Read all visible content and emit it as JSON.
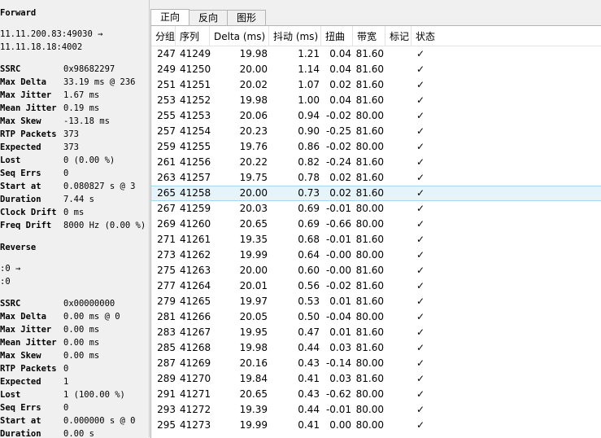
{
  "left": {
    "forward": {
      "title": "Forward",
      "addr1": "11.11.200.83:49030 →",
      "addr2": "11.11.18.18:4002",
      "stats": [
        {
          "k": "SSRC",
          "v": "0x98682297"
        },
        {
          "k": "Max Delta",
          "v": "33.19 ms @ 236"
        },
        {
          "k": "Max Jitter",
          "v": "1.67 ms"
        },
        {
          "k": "Mean Jitter",
          "v": "0.19 ms"
        },
        {
          "k": "Max Skew",
          "v": "-13.18 ms"
        },
        {
          "k": "RTP Packets",
          "v": "373"
        },
        {
          "k": "Expected",
          "v": "373"
        },
        {
          "k": "Lost",
          "v": "0 (0.00 %)"
        },
        {
          "k": "Seq Errs",
          "v": "0"
        },
        {
          "k": "Start at",
          "v": "0.080827 s @ 3"
        },
        {
          "k": "Duration",
          "v": "7.44 s"
        },
        {
          "k": "Clock Drift",
          "v": "0 ms"
        },
        {
          "k": "Freq Drift",
          "v": "8000 Hz (0.00 %)"
        }
      ]
    },
    "reverse": {
      "title": "Reverse",
      "addr1": ":0 →",
      "addr2": ":0",
      "stats": [
        {
          "k": "SSRC",
          "v": "0x00000000"
        },
        {
          "k": "Max Delta",
          "v": "0.00 ms @ 0"
        },
        {
          "k": "Max Jitter",
          "v": "0.00 ms"
        },
        {
          "k": "Mean Jitter",
          "v": "0.00 ms"
        },
        {
          "k": "Max Skew",
          "v": "0.00 ms"
        },
        {
          "k": "RTP Packets",
          "v": "0"
        },
        {
          "k": "Expected",
          "v": "1"
        },
        {
          "k": "Lost",
          "v": "1 (100.00 %)"
        },
        {
          "k": "Seq Errs",
          "v": "0"
        },
        {
          "k": "Start at",
          "v": "0.000000 s @ 0"
        },
        {
          "k": "Duration",
          "v": "0.00 s"
        }
      ]
    }
  },
  "tabs": [
    "正向",
    "反向",
    "图形"
  ],
  "active_tab": 0,
  "columns": [
    "分组",
    "序列",
    "Delta (ms)",
    "抖动 (ms)",
    "扭曲",
    "带宽",
    "标记",
    "状态"
  ],
  "selected_row": 9,
  "rows": [
    {
      "pkt": "247",
      "seq": "41249",
      "delta": "19.98",
      "jitter": "1.21",
      "skew": "0.04",
      "bw": "81.60",
      "mark": "",
      "status": "✓"
    },
    {
      "pkt": "249",
      "seq": "41250",
      "delta": "20.00",
      "jitter": "1.14",
      "skew": "0.04",
      "bw": "81.60",
      "mark": "",
      "status": "✓"
    },
    {
      "pkt": "251",
      "seq": "41251",
      "delta": "20.02",
      "jitter": "1.07",
      "skew": "0.02",
      "bw": "81.60",
      "mark": "",
      "status": "✓"
    },
    {
      "pkt": "253",
      "seq": "41252",
      "delta": "19.98",
      "jitter": "1.00",
      "skew": "0.04",
      "bw": "81.60",
      "mark": "",
      "status": "✓"
    },
    {
      "pkt": "255",
      "seq": "41253",
      "delta": "20.06",
      "jitter": "0.94",
      "skew": "-0.02",
      "bw": "80.00",
      "mark": "",
      "status": "✓"
    },
    {
      "pkt": "257",
      "seq": "41254",
      "delta": "20.23",
      "jitter": "0.90",
      "skew": "-0.25",
      "bw": "81.60",
      "mark": "",
      "status": "✓"
    },
    {
      "pkt": "259",
      "seq": "41255",
      "delta": "19.76",
      "jitter": "0.86",
      "skew": "-0.02",
      "bw": "80.00",
      "mark": "",
      "status": "✓"
    },
    {
      "pkt": "261",
      "seq": "41256",
      "delta": "20.22",
      "jitter": "0.82",
      "skew": "-0.24",
      "bw": "81.60",
      "mark": "",
      "status": "✓"
    },
    {
      "pkt": "263",
      "seq": "41257",
      "delta": "19.75",
      "jitter": "0.78",
      "skew": "0.02",
      "bw": "81.60",
      "mark": "",
      "status": "✓"
    },
    {
      "pkt": "265",
      "seq": "41258",
      "delta": "20.00",
      "jitter": "0.73",
      "skew": "0.02",
      "bw": "81.60",
      "mark": "",
      "status": "✓"
    },
    {
      "pkt": "267",
      "seq": "41259",
      "delta": "20.03",
      "jitter": "0.69",
      "skew": "-0.01",
      "bw": "80.00",
      "mark": "",
      "status": "✓"
    },
    {
      "pkt": "269",
      "seq": "41260",
      "delta": "20.65",
      "jitter": "0.69",
      "skew": "-0.66",
      "bw": "80.00",
      "mark": "",
      "status": "✓"
    },
    {
      "pkt": "271",
      "seq": "41261",
      "delta": "19.35",
      "jitter": "0.68",
      "skew": "-0.01",
      "bw": "81.60",
      "mark": "",
      "status": "✓"
    },
    {
      "pkt": "273",
      "seq": "41262",
      "delta": "19.99",
      "jitter": "0.64",
      "skew": "-0.00",
      "bw": "80.00",
      "mark": "",
      "status": "✓"
    },
    {
      "pkt": "275",
      "seq": "41263",
      "delta": "20.00",
      "jitter": "0.60",
      "skew": "-0.00",
      "bw": "81.60",
      "mark": "",
      "status": "✓"
    },
    {
      "pkt": "277",
      "seq": "41264",
      "delta": "20.01",
      "jitter": "0.56",
      "skew": "-0.02",
      "bw": "81.60",
      "mark": "",
      "status": "✓"
    },
    {
      "pkt": "279",
      "seq": "41265",
      "delta": "19.97",
      "jitter": "0.53",
      "skew": "0.01",
      "bw": "81.60",
      "mark": "",
      "status": "✓"
    },
    {
      "pkt": "281",
      "seq": "41266",
      "delta": "20.05",
      "jitter": "0.50",
      "skew": "-0.04",
      "bw": "80.00",
      "mark": "",
      "status": "✓"
    },
    {
      "pkt": "283",
      "seq": "41267",
      "delta": "19.95",
      "jitter": "0.47",
      "skew": "0.01",
      "bw": "81.60",
      "mark": "",
      "status": "✓"
    },
    {
      "pkt": "285",
      "seq": "41268",
      "delta": "19.98",
      "jitter": "0.44",
      "skew": "0.03",
      "bw": "81.60",
      "mark": "",
      "status": "✓"
    },
    {
      "pkt": "287",
      "seq": "41269",
      "delta": "20.16",
      "jitter": "0.43",
      "skew": "-0.14",
      "bw": "80.00",
      "mark": "",
      "status": "✓"
    },
    {
      "pkt": "289",
      "seq": "41270",
      "delta": "19.84",
      "jitter": "0.41",
      "skew": "0.03",
      "bw": "81.60",
      "mark": "",
      "status": "✓"
    },
    {
      "pkt": "291",
      "seq": "41271",
      "delta": "20.65",
      "jitter": "0.43",
      "skew": "-0.62",
      "bw": "80.00",
      "mark": "",
      "status": "✓"
    },
    {
      "pkt": "293",
      "seq": "41272",
      "delta": "19.39",
      "jitter": "0.44",
      "skew": "-0.01",
      "bw": "80.00",
      "mark": "",
      "status": "✓"
    },
    {
      "pkt": "295",
      "seq": "41273",
      "delta": "19.99",
      "jitter": "0.41",
      "skew": "0.00",
      "bw": "80.00",
      "mark": "",
      "status": "✓"
    }
  ]
}
